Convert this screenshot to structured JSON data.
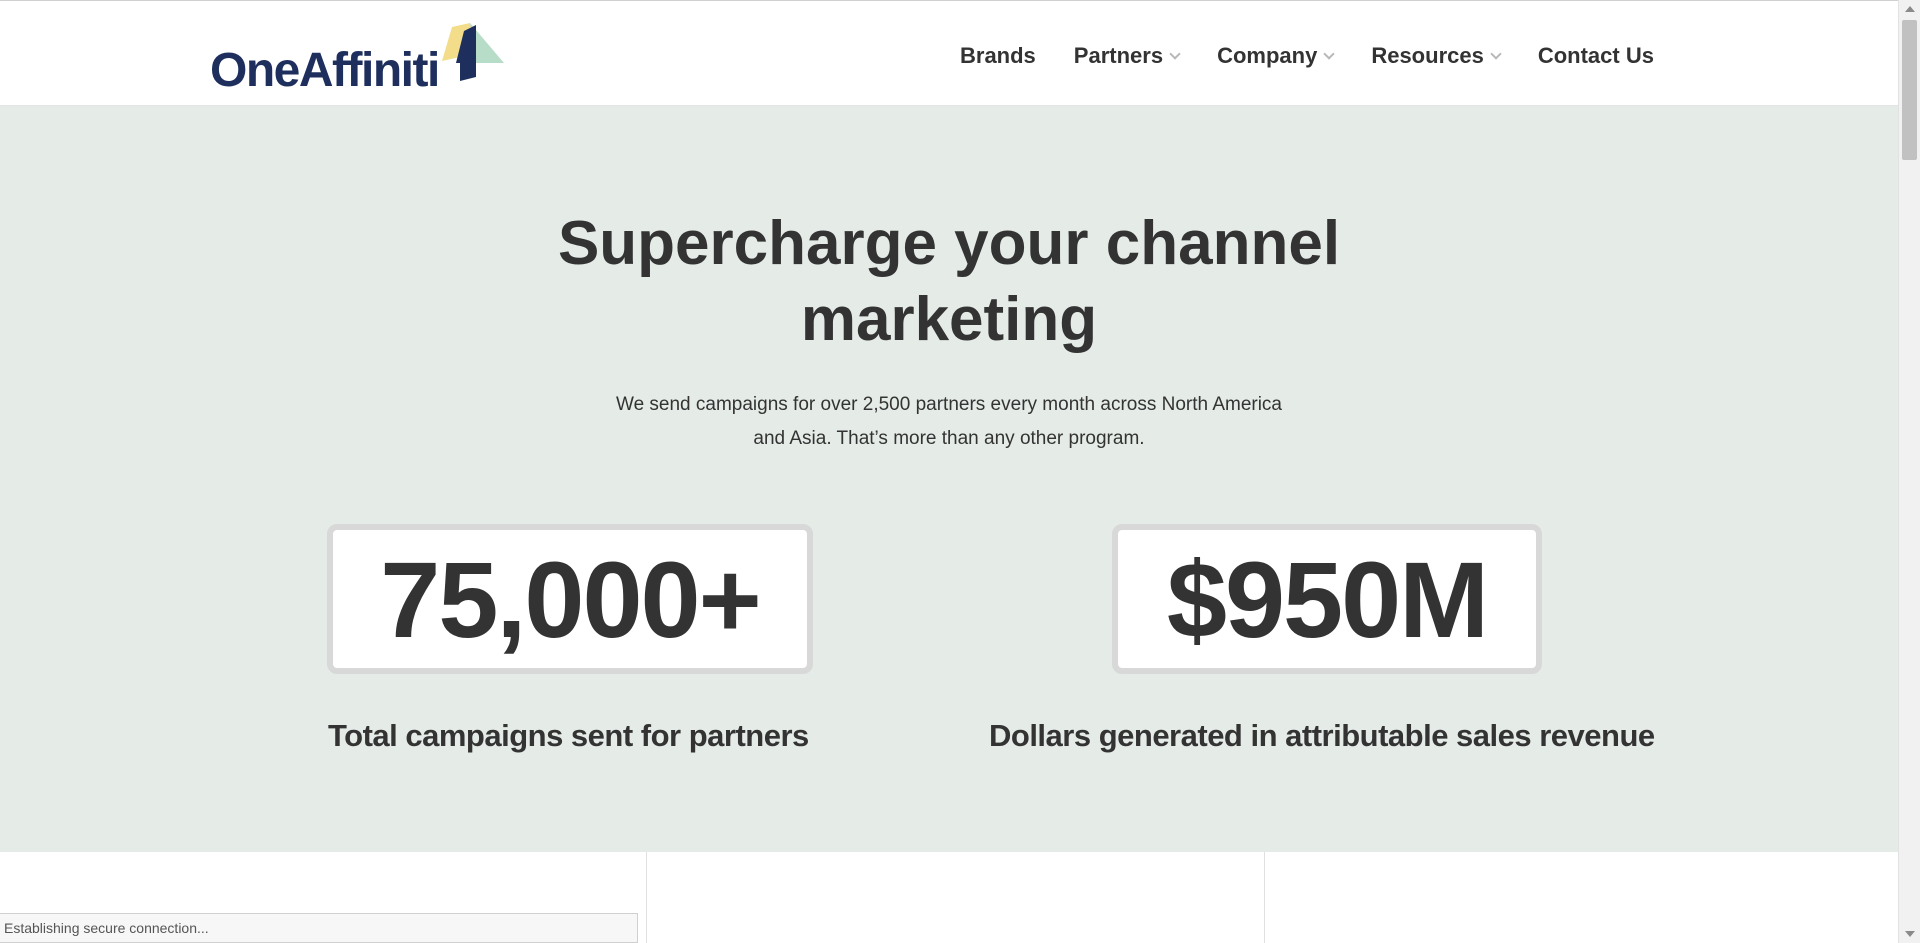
{
  "header": {
    "logo_text": "OneAffiniti",
    "nav": [
      {
        "label": "Brands",
        "dropdown": false
      },
      {
        "label": "Partners",
        "dropdown": true
      },
      {
        "label": "Company",
        "dropdown": true
      },
      {
        "label": "Resources",
        "dropdown": true
      },
      {
        "label": "Contact Us",
        "dropdown": false
      }
    ]
  },
  "hero": {
    "title_line1": "Supercharge your channel",
    "title_line2": "marketing",
    "subtitle_line1": "We send campaigns for over 2,500 partners every month across North America",
    "subtitle_line2": "and Asia. That’s more than any other program."
  },
  "stats": [
    {
      "value": "75,000+",
      "label": "Total campaigns sent for partners"
    },
    {
      "value": "$950M",
      "label": "Dollars generated in attributable sales revenue"
    }
  ],
  "status_bar": {
    "text": "Establishing secure connection..."
  },
  "colors": {
    "logo_navy": "#1e2f5e",
    "logo_yellow": "#f3dc8a",
    "logo_mint": "#b7dcc8",
    "hero_bg": "#e5ebe7",
    "text_dark": "#333333"
  },
  "icons": {
    "dropdown": "chevron-down-icon",
    "logo_mark": "logo-mark-icon"
  }
}
